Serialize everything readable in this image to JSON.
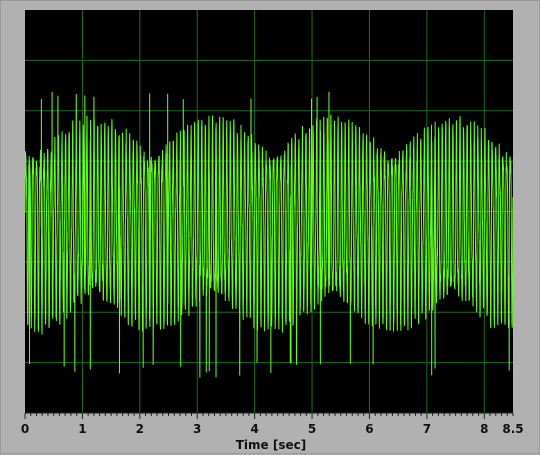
{
  "chart_data": {
    "type": "line",
    "title": "",
    "xlabel": "Time [sec]",
    "ylabel": "",
    "xlim": [
      0,
      8.5
    ],
    "x_ticks": [
      0,
      1,
      2,
      3,
      4,
      5,
      6,
      7,
      8,
      8.5
    ],
    "x_tick_labels": [
      "0",
      "1",
      "2",
      "3",
      "4",
      "5",
      "6",
      "7",
      "8",
      "8.5"
    ],
    "ylim": [
      -4,
      4
    ],
    "y_grid_values": [
      -3,
      -2,
      -1,
      0,
      1,
      2,
      3
    ],
    "grid": true,
    "legend": "none",
    "series": [
      {
        "color": "#66ff1a",
        "description_of_signal": "dense oscillation, roughly 16 cycles per second",
        "dominant_frequency_hz": 16,
        "upper_envelope": 1.8,
        "lower_envelope": -2.3,
        "occasional_spike_min": -3.3,
        "occasional_spike_max": 2.4,
        "start_x": 0,
        "end_x": 8.5
      }
    ],
    "colors": {
      "plot_background": "#000000",
      "grid": "#1f6b1f",
      "trace": "#66ff1a",
      "frame": "#b1b1b1"
    }
  }
}
